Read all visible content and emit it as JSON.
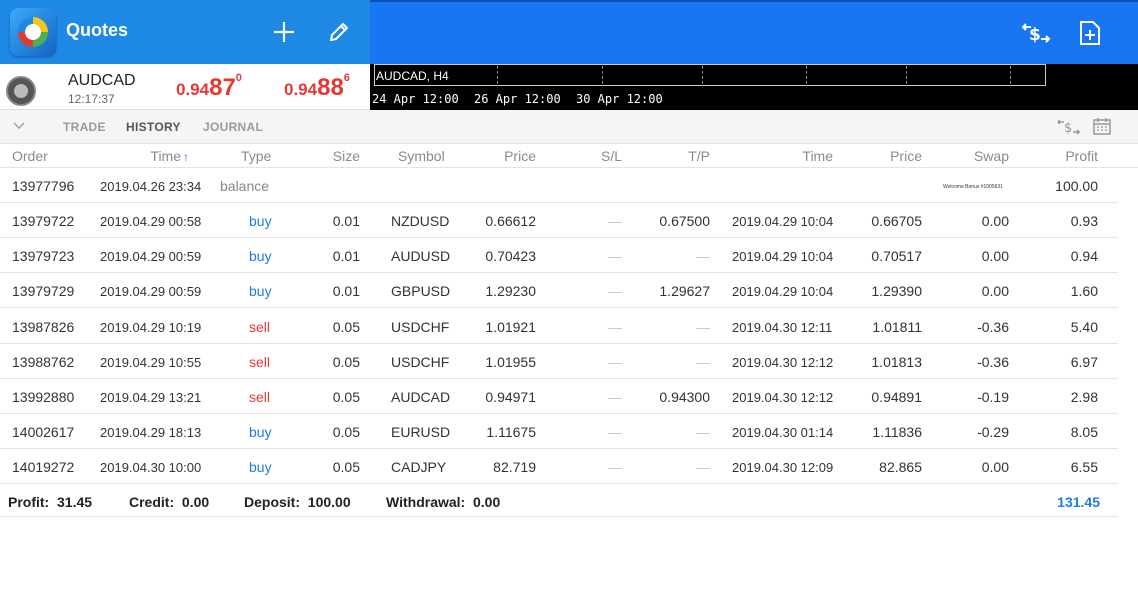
{
  "app": {
    "title": "Quotes"
  },
  "quote": {
    "symbol": "AUDCAD",
    "time": "12:17:37",
    "bid": {
      "prefix": "0.94",
      "big": "87",
      "sup": "0"
    },
    "ask": {
      "prefix": "0.94",
      "big": "88",
      "sup": "6"
    }
  },
  "chart": {
    "title": "AUDCAD, H4",
    "ticks": [
      "24 Apr 12:00",
      "26 Apr 12:00",
      "30 Apr 12:00"
    ]
  },
  "tabs": [
    "TRADE",
    "HISTORY",
    "JOURNAL"
  ],
  "active_tab": "HISTORY",
  "columns": {
    "order": "Order",
    "time": "Time",
    "sort_arrow": "↑",
    "type": "Type",
    "size": "Size",
    "symbol": "Symbol",
    "price": "Price",
    "sl": "S/L",
    "tp": "T/P",
    "close_time": "Time",
    "close_price": "Price",
    "swap": "Swap",
    "profit": "Profit"
  },
  "balance_row": {
    "order": "13977796",
    "time": "2019.04.26 23:34",
    "type": "balance",
    "comment": "Welcome Bonus #1005631",
    "profit": "100.00"
  },
  "trades": [
    {
      "order": "13979722",
      "time": "2019.04.29 00:58",
      "type": "buy",
      "size": "0.01",
      "symbol": "NZDUSD",
      "price": "0.66612",
      "sl": "—",
      "tp": "0.67500",
      "close_time": "2019.04.29 10:04",
      "close_price": "0.66705",
      "swap": "0.00",
      "profit": "0.93"
    },
    {
      "order": "13979723",
      "time": "2019.04.29 00:59",
      "type": "buy",
      "size": "0.01",
      "symbol": "AUDUSD",
      "price": "0.70423",
      "sl": "—",
      "tp": "—",
      "close_time": "2019.04.29 10:04",
      "close_price": "0.70517",
      "swap": "0.00",
      "profit": "0.94"
    },
    {
      "order": "13979729",
      "time": "2019.04.29 00:59",
      "type": "buy",
      "size": "0.01",
      "symbol": "GBPUSD",
      "price": "1.29230",
      "sl": "—",
      "tp": "1.29627",
      "close_time": "2019.04.29 10:04",
      "close_price": "1.29390",
      "swap": "0.00",
      "profit": "1.60"
    },
    {
      "order": "13987826",
      "time": "2019.04.29 10:19",
      "type": "sell",
      "size": "0.05",
      "symbol": "USDCHF",
      "price": "1.01921",
      "sl": "—",
      "tp": "—",
      "close_time": "2019.04.30 12:11",
      "close_price": "1.01811",
      "swap": "-0.36",
      "profit": "5.40"
    },
    {
      "order": "13988762",
      "time": "2019.04.29 10:55",
      "type": "sell",
      "size": "0.05",
      "symbol": "USDCHF",
      "price": "1.01955",
      "sl": "—",
      "tp": "—",
      "close_time": "2019.04.30 12:12",
      "close_price": "1.01813",
      "swap": "-0.36",
      "profit": "6.97"
    },
    {
      "order": "13992880",
      "time": "2019.04.29 13:21",
      "type": "sell",
      "size": "0.05",
      "symbol": "AUDCAD",
      "price": "0.94971",
      "sl": "—",
      "tp": "0.94300",
      "close_time": "2019.04.30 12:12",
      "close_price": "0.94891",
      "swap": "-0.19",
      "profit": "2.98"
    },
    {
      "order": "14002617",
      "time": "2019.04.29 18:13",
      "type": "buy",
      "size": "0.05",
      "symbol": "EURUSD",
      "price": "1.11675",
      "sl": "—",
      "tp": "—",
      "close_time": "2019.04.30 01:14",
      "close_price": "1.11836",
      "swap": "-0.29",
      "profit": "8.05"
    },
    {
      "order": "14019272",
      "time": "2019.04.30 10:00",
      "type": "buy",
      "size": "0.05",
      "symbol": "CADJPY",
      "price": "82.719",
      "sl": "—",
      "tp": "—",
      "close_time": "2019.04.30 12:09",
      "close_price": "82.865",
      "swap": "0.00",
      "profit": "6.55"
    }
  ],
  "summary": {
    "profit_label": "Profit:",
    "profit": "31.45",
    "credit_label": "Credit:",
    "credit": "0.00",
    "deposit_label": "Deposit:",
    "deposit": "100.00",
    "withdrawal_label": "Withdrawal:",
    "withdrawal": "0.00",
    "total": "131.45"
  },
  "colors": {
    "accent": "#1e88e5",
    "buy": "#1e7be6",
    "sell": "#e53935",
    "total": "#1e7be6"
  },
  "icons": [
    "app-logo-icon",
    "add-icon",
    "edit-icon",
    "trade-currency-icon",
    "new-file-icon",
    "profile-icon",
    "chevron-down-icon",
    "currency-sort-icon",
    "calendar-icon"
  ]
}
